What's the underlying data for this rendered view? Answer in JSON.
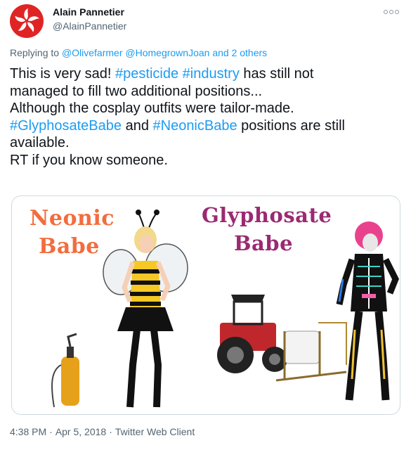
{
  "tweet": {
    "author_name": "Alain Pannetier",
    "author_handle": "@AlainPannetier",
    "replying_to_prefix": "Replying to",
    "replying_to": [
      "@Olivefarmer",
      "@Homegrown​Joan"
    ],
    "replying_others": "and 2 others",
    "body": {
      "l1_a": "This is very sad! ",
      "l1_tag1": "#pesticide",
      "l1_sp": " ",
      "l1_tag2": "#industry",
      "l1_b": " has still not",
      "l2": "managed to fill two additional positions...",
      "l3": "Although the cosplay outfits were tailor-made.",
      "l4_tag1": "#GlyphosateBabe",
      "l4_and": " and ",
      "l4_tag2": "#NeonicBabe",
      "l4_b": " positions are still",
      "l5": "available.",
      "l6": "RT if you know someone."
    },
    "media": {
      "left_title_1": "Neonic",
      "left_title_2": "Babe",
      "right_title_1": "Glyphosate",
      "right_title_2": "Babe"
    },
    "footer": {
      "time": "4:38 PM",
      "date": "Apr 5, 2018",
      "client": "Twitter Web Client",
      "separator": "·"
    }
  },
  "colors": {
    "link": "#1d9bf0",
    "avatar_bg": "#e02424",
    "neonic_title": "#f26d3d",
    "glyphosate_title": "#9b2a72"
  },
  "icons": {
    "more": "more-dots-icon",
    "avatar": "bauhinia-flower-icon"
  }
}
